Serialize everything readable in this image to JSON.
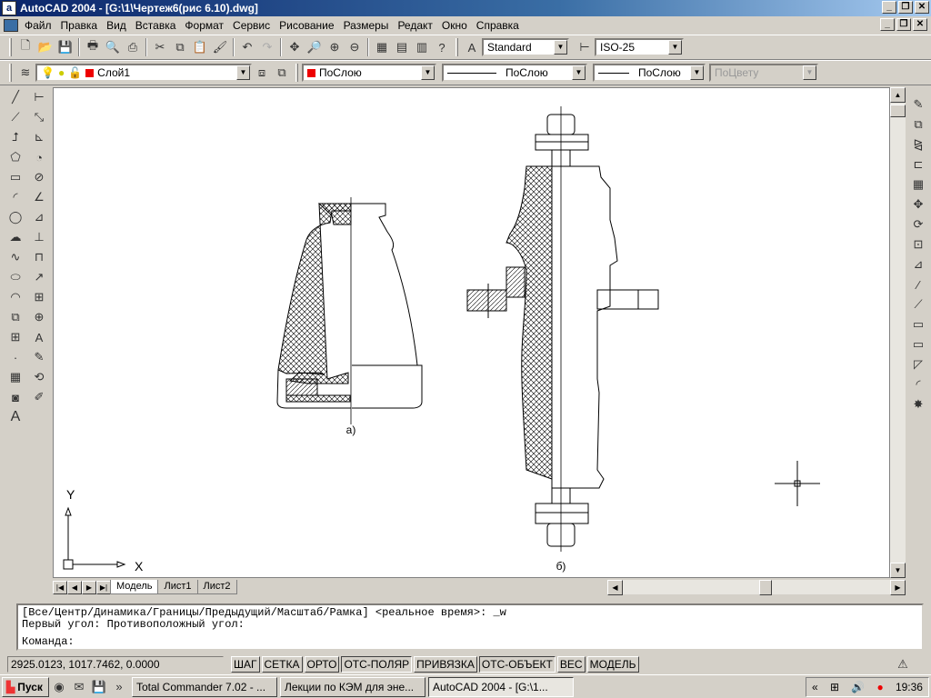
{
  "title": "AutoCAD 2004 - [G:\\1\\Чертеж6(рис 6.10).dwg]",
  "menu": [
    "Файл",
    "Правка",
    "Вид",
    "Вставка",
    "Формат",
    "Сервис",
    "Рисование",
    "Размеры",
    "Редакт",
    "Окно",
    "Справка"
  ],
  "toolbar": {
    "text_style": "Standard",
    "dim_style": "ISO-25",
    "layer": "Слой1",
    "color": "ПоСлою",
    "linetype": "ПоСлою",
    "lineweight": "ПоСлою",
    "plotstyle": "ПоЦвету"
  },
  "drawing": {
    "label_a": "а)",
    "label_b": "б)",
    "ucs_x": "X",
    "ucs_y": "Y"
  },
  "tabs": [
    "Модель",
    "Лист1",
    "Лист2"
  ],
  "command": {
    "line1": "[Все/Центр/Динамика/Границы/Предыдущий/Масштаб/Рамка] <реальное время>: _w",
    "line2": "Первый угол: Противоположный угол:",
    "line3": "Команда:"
  },
  "status": {
    "coords": "2925.0123, 1017.7462, 0.0000",
    "buttons": [
      "ШАГ",
      "СЕТКА",
      "ОРТО",
      "ОТС-ПОЛЯР",
      "ПРИВЯЗКА",
      "ОТС-ОБЪЕКТ",
      "ВЕС",
      "МОДЕЛЬ"
    ]
  },
  "taskbar": {
    "start": "Пуск",
    "tasks": [
      "Total Commander 7.02 - ...",
      "Лекции по КЭМ для эне...",
      "AutoCAD 2004 - [G:\\1..."
    ],
    "clock": "19:36"
  }
}
